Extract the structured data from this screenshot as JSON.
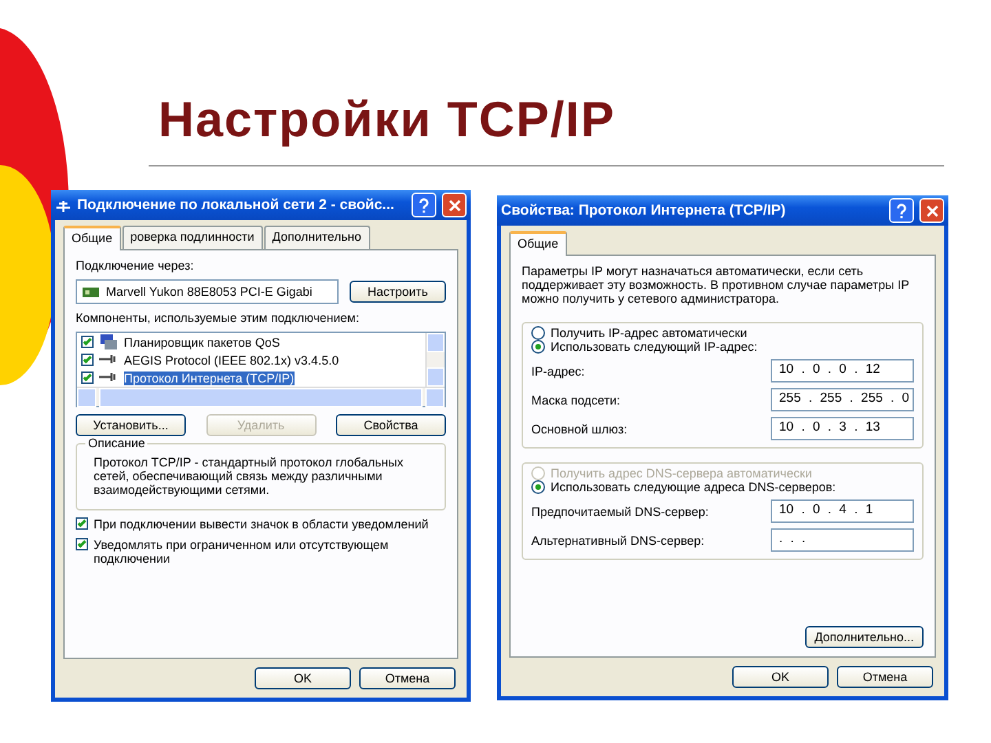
{
  "slide": {
    "title": "Настройки TCP/IP"
  },
  "left_window": {
    "title": "Подключение по локальной сети 2 - свойс...",
    "tabs": [
      {
        "label": "Общие",
        "selected": true
      },
      {
        "label": "роверка подлинности",
        "selected": false
      },
      {
        "label": "Дополнительно",
        "selected": false
      }
    ],
    "connect_label": "Подключение через:",
    "adapter": "Marvell Yukon 88E8053 PCI-E Gigabi",
    "configure_button": "Настроить",
    "components_label": "Компоненты, используемые этим подключением:",
    "components": [
      {
        "kind": "service",
        "label": "Планировщик пакетов QoS",
        "checked": true,
        "selected": false
      },
      {
        "kind": "protocol",
        "label": "AEGIS Protocol (IEEE 802.1x) v3.4.5.0",
        "checked": true,
        "selected": false
      },
      {
        "kind": "protocol",
        "label": "Протокол Интернета (TCP/IP)",
        "checked": true,
        "selected": true
      }
    ],
    "buttons": [
      {
        "label": "Установить...",
        "disabled": false
      },
      {
        "label": "Удалить",
        "disabled": true
      },
      {
        "label": "Свойства",
        "disabled": false
      }
    ],
    "description": {
      "legend": "Описание",
      "text": "Протокол TCP/IP - стандартный протокол глобальных сетей, обеспечивающий связь между различными взаимодействующими сетями."
    },
    "options": [
      {
        "label": "При подключении вывести значок в области уведомлений",
        "checked": true
      },
      {
        "label": "Уведомлять при ограниченном или отсутствующем подключении",
        "checked": true
      }
    ],
    "footer_buttons": [
      "OK",
      "Отмена"
    ]
  },
  "right_window": {
    "title": "Свойства: Протокол Интернета (TCP/IP)",
    "tabs": [
      {
        "label": "Общие",
        "selected": true
      }
    ],
    "intro": "Параметры IP могут назначаться автоматически, если сеть поддерживает эту возможность. В противном случае параметры IP можно получить у сетевого администратора.",
    "ip_modes": [
      {
        "label": "Получить IP-адрес автоматически",
        "selected": false,
        "disabled": false
      },
      {
        "label": "Использовать следующий IP-адрес:",
        "selected": true,
        "disabled": false
      }
    ],
    "ip_fields": [
      {
        "label": "IP-адрес:",
        "value": "10 . 0 . 0 . 12"
      },
      {
        "label": "Маска подсети:",
        "value": "255 . 255 . 255 . 0"
      },
      {
        "label": "Основной шлюз:",
        "value": "10 . 0 . 3 . 13"
      }
    ],
    "dns_modes": [
      {
        "label": "Получить адрес DNS-сервера автоматически",
        "selected": false,
        "disabled": true
      },
      {
        "label": "Использовать следующие адреса DNS-серверов:",
        "selected": true,
        "disabled": false
      }
    ],
    "dns_fields": [
      {
        "label": "Предпочитаемый DNS-сервер:",
        "value": "10 . 0 . 4 . 1"
      },
      {
        "label": "Альтернативный DNS-сервер:",
        "value": ". . ."
      }
    ],
    "advanced_button": "Дополнительно...",
    "footer_buttons": [
      "OK",
      "Отмена"
    ]
  }
}
